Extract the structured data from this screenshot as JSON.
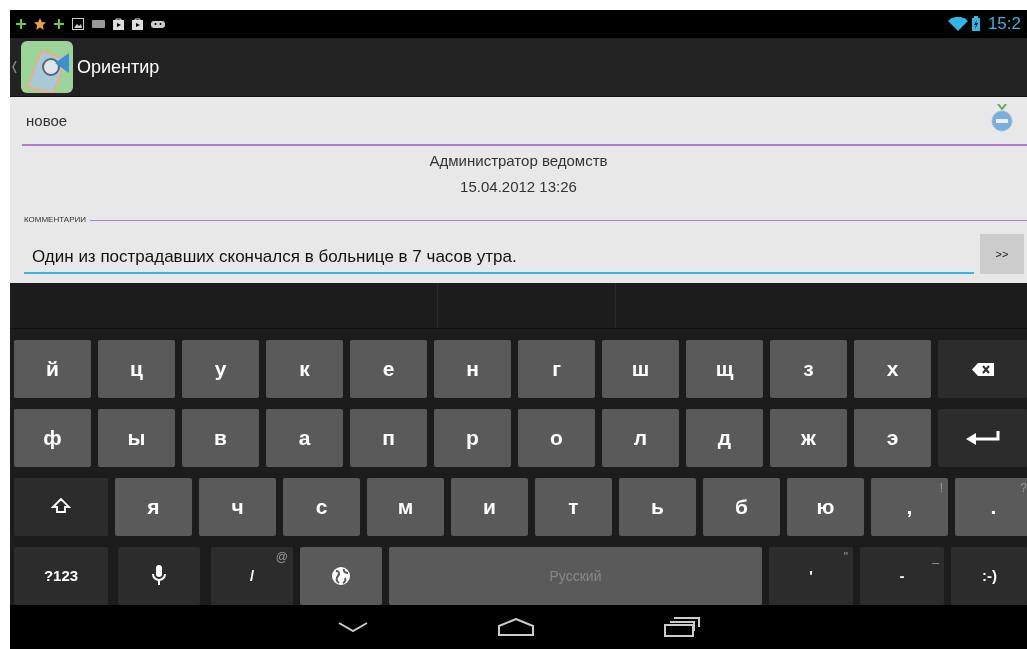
{
  "status_bar": {
    "time": "15:2"
  },
  "action_bar": {
    "title": "Ориентир"
  },
  "form": {
    "status_field": {
      "value": "новое"
    },
    "author": "Администратор ведомств",
    "date": "15.04.2012 13:26",
    "comments": {
      "label": "КОММЕНТАРИИ",
      "value": "Один из пострадавших скончался в больнице в 7 часов утра.",
      "send": ">>"
    }
  },
  "keyboard": {
    "rows": [
      {
        "keys": [
          {
            "kind": "letter",
            "label": "й"
          },
          {
            "kind": "letter",
            "label": "ц"
          },
          {
            "kind": "letter",
            "label": "у"
          },
          {
            "kind": "letter",
            "label": "к"
          },
          {
            "kind": "letter",
            "label": "е"
          },
          {
            "kind": "letter",
            "label": "н"
          },
          {
            "kind": "letter",
            "label": "г"
          },
          {
            "kind": "letter",
            "label": "ш"
          },
          {
            "kind": "letter",
            "label": "щ"
          },
          {
            "kind": "letter",
            "label": "з"
          },
          {
            "kind": "letter",
            "label": "х"
          },
          {
            "kind": "backspace"
          }
        ]
      },
      {
        "keys": [
          {
            "kind": "letter",
            "label": "ф"
          },
          {
            "kind": "letter",
            "label": "ы"
          },
          {
            "kind": "letter",
            "label": "в"
          },
          {
            "kind": "letter",
            "label": "а"
          },
          {
            "kind": "letter",
            "label": "п"
          },
          {
            "kind": "letter",
            "label": "р"
          },
          {
            "kind": "letter",
            "label": "о"
          },
          {
            "kind": "letter",
            "label": "л"
          },
          {
            "kind": "letter",
            "label": "д"
          },
          {
            "kind": "letter",
            "label": "ж"
          },
          {
            "kind": "letter",
            "label": "э"
          },
          {
            "kind": "enter"
          }
        ]
      },
      {
        "keys": [
          {
            "kind": "shift"
          },
          {
            "kind": "letter",
            "label": "я"
          },
          {
            "kind": "letter",
            "label": "ч"
          },
          {
            "kind": "letter",
            "label": "с"
          },
          {
            "kind": "letter",
            "label": "м"
          },
          {
            "kind": "letter",
            "label": "и"
          },
          {
            "kind": "letter",
            "label": "т"
          },
          {
            "kind": "letter",
            "label": "ь"
          },
          {
            "kind": "letter",
            "label": "б"
          },
          {
            "kind": "letter",
            "label": "ю"
          },
          {
            "kind": "letter",
            "label": ",",
            "hint": "!"
          },
          {
            "kind": "letter",
            "label": ".",
            "hint": "?"
          }
        ]
      },
      {
        "keys": [
          {
            "kind": "function",
            "label": "?123"
          },
          {
            "kind": "mic"
          },
          {
            "kind": "function",
            "label": "/",
            "hint": "@"
          },
          {
            "kind": "globe"
          },
          {
            "kind": "space",
            "label": "Русский"
          },
          {
            "kind": "function",
            "label": "'",
            "hint": "\""
          },
          {
            "kind": "function",
            "label": "-",
            "hint": "_"
          },
          {
            "kind": "function",
            "label": ":-)"
          }
        ]
      }
    ]
  }
}
